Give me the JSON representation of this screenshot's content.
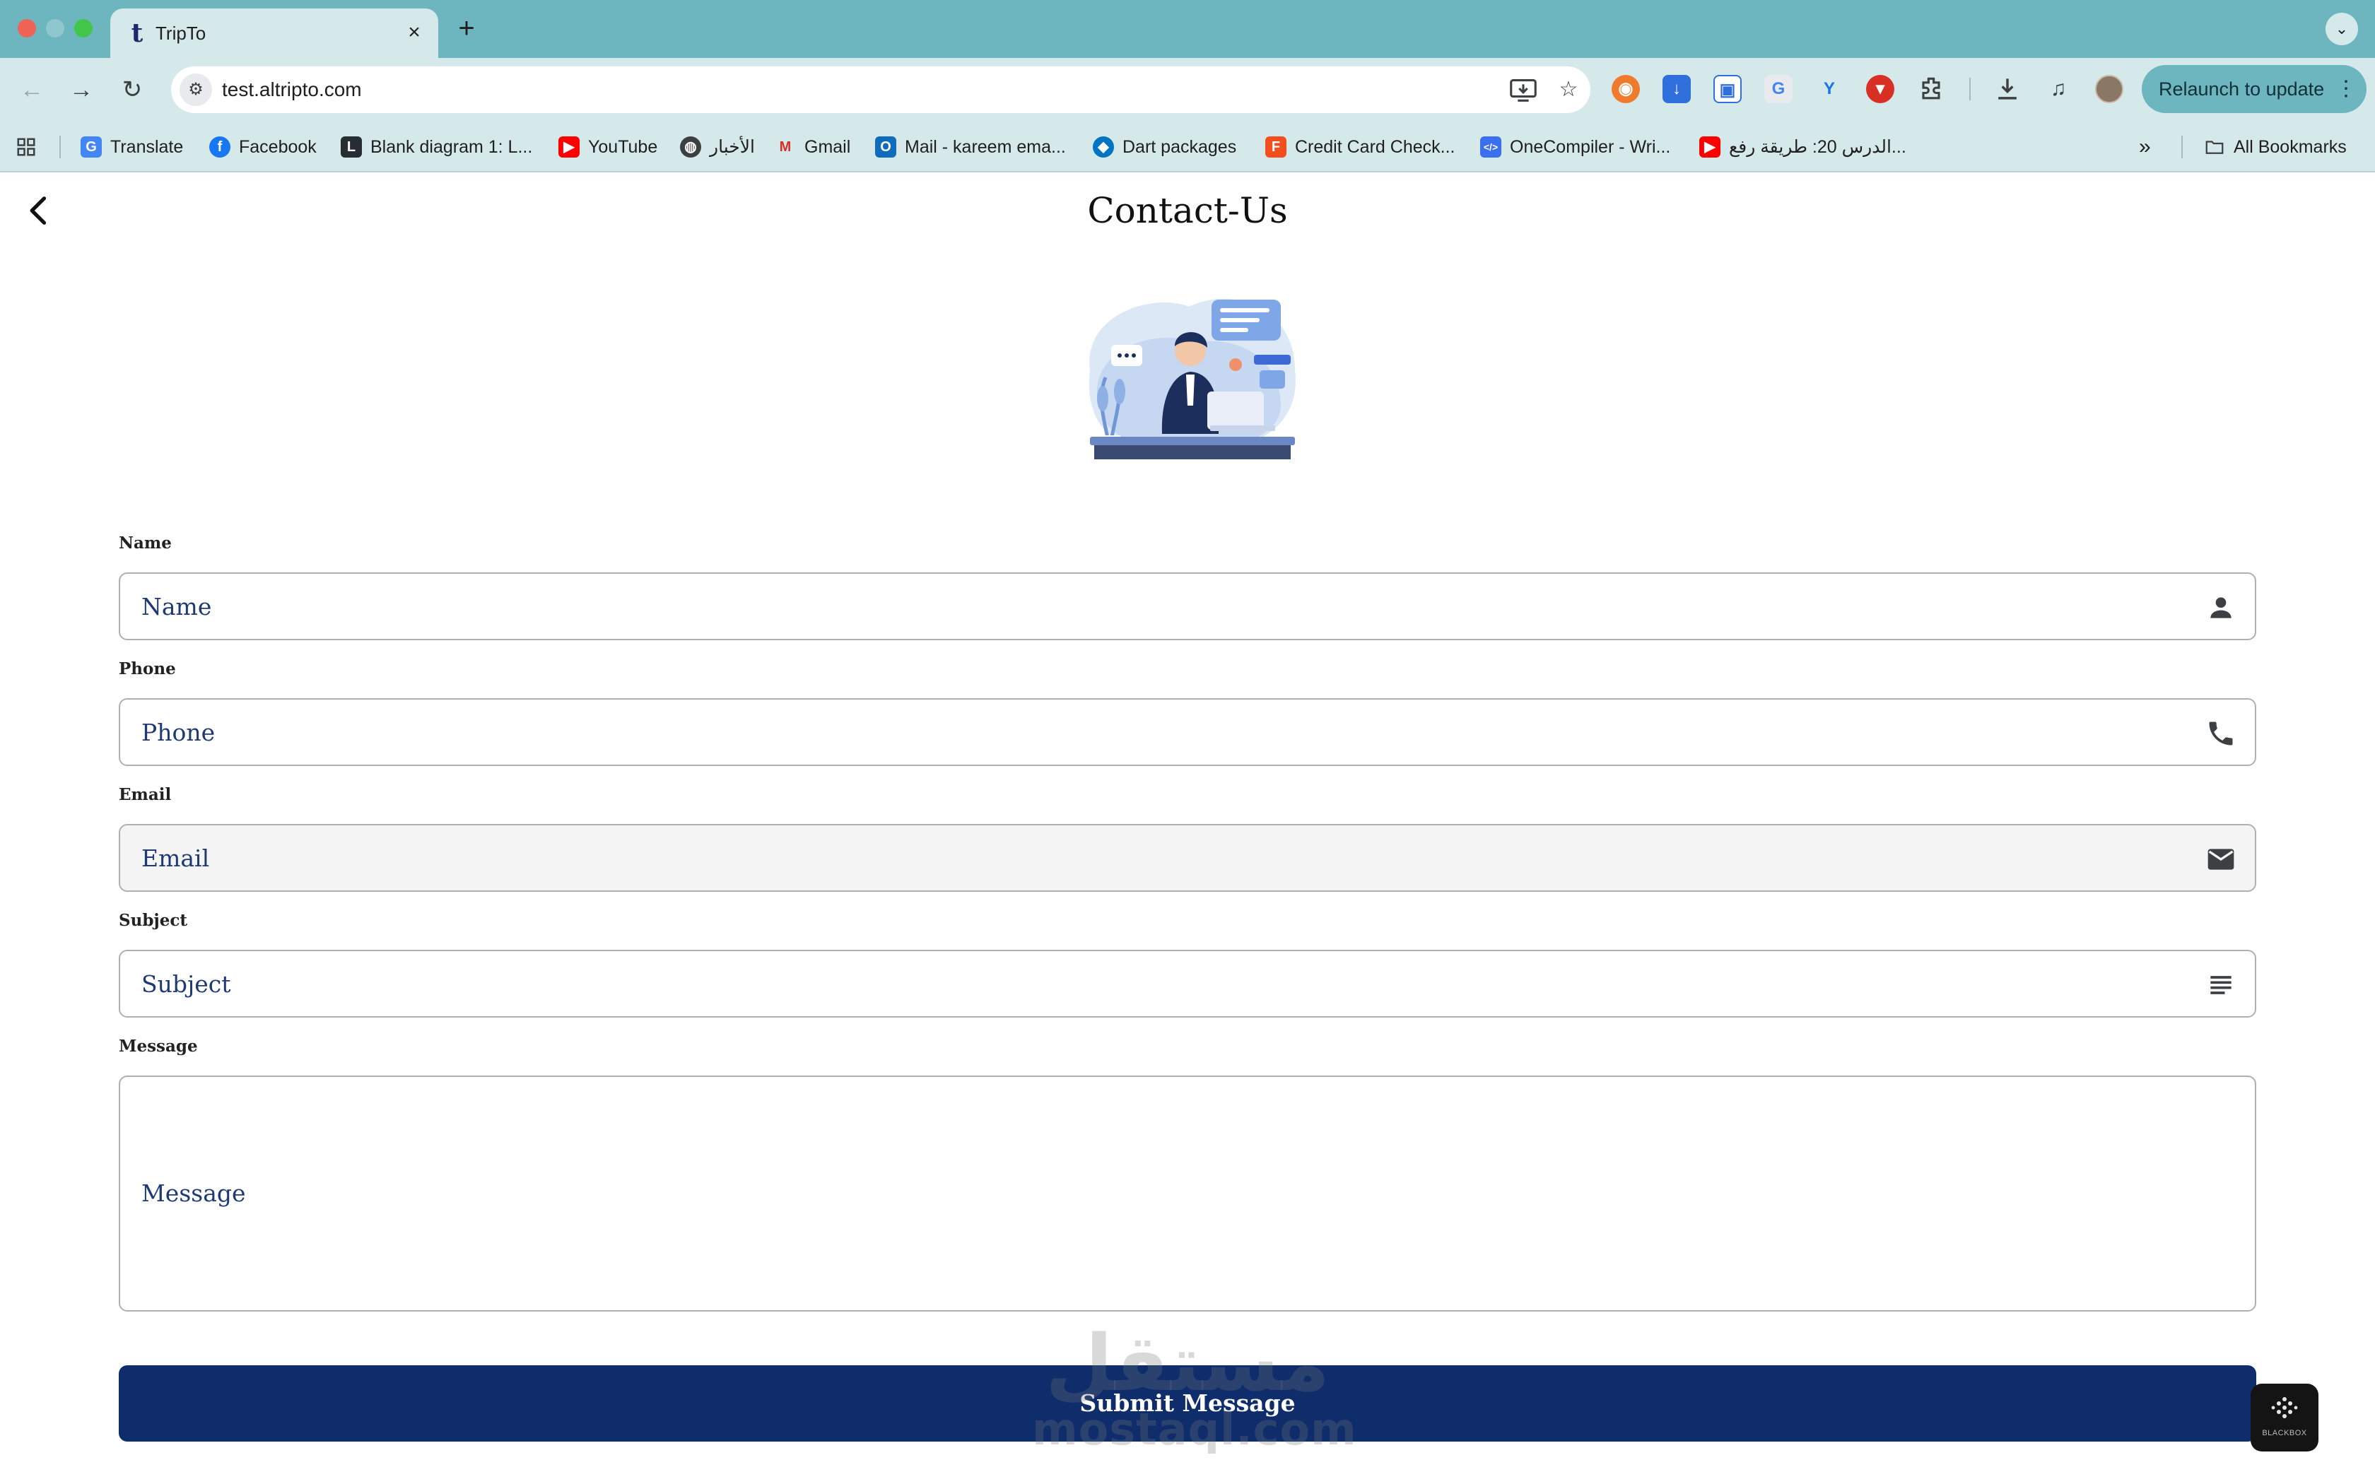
{
  "browser": {
    "tab": {
      "title": "TripTo",
      "favicon": "t"
    },
    "address_bar": {
      "url": "test.altripto.com"
    },
    "relaunch_label": "Relaunch to update",
    "bookmarks": [
      {
        "label": "Translate",
        "icon": "google-translate-icon"
      },
      {
        "label": "Facebook",
        "icon": "facebook-icon"
      },
      {
        "label": "Blank diagram 1: L...",
        "icon": "lucidchart-icon"
      },
      {
        "label": "YouTube",
        "icon": "youtube-icon"
      },
      {
        "label": "الأخبار",
        "icon": "globe-icon"
      },
      {
        "label": "Gmail",
        "icon": "gmail-icon"
      },
      {
        "label": "Mail - kareem ema...",
        "icon": "outlook-icon"
      },
      {
        "label": "Dart packages",
        "icon": "dart-icon"
      },
      {
        "label": "Credit Card Check...",
        "icon": "figma-icon"
      },
      {
        "label": "OneCompiler - Wri...",
        "icon": "code-icon"
      },
      {
        "label": "الدرس 20: طريقة رفع...",
        "icon": "youtube-icon"
      }
    ],
    "all_bookmarks_label": "All Bookmarks"
  },
  "page": {
    "title": "Contact-Us",
    "illustration": "customer-support-agent-illustration",
    "form": {
      "name": {
        "label": "Name",
        "placeholder": "Name",
        "icon": "person-icon"
      },
      "phone": {
        "label": "Phone",
        "placeholder": "Phone",
        "icon": "phone-icon"
      },
      "email": {
        "label": "Email",
        "placeholder": "Email",
        "icon": "envelope-icon"
      },
      "subject": {
        "label": "Subject",
        "placeholder": "Subject",
        "icon": "subject-lines-icon"
      },
      "message": {
        "label": "Message",
        "placeholder": "Message"
      },
      "submit_label": "Submit Message"
    },
    "watermark": {
      "arabic": "مستقل",
      "latin": "mostaql.com"
    },
    "floating_badge": "BLACKBOX"
  },
  "colors": {
    "tab_strip": "#6db6bf",
    "toolbar": "#d6e9ea",
    "primary_button": "#0f2d6b",
    "placeholder_text": "#1f3a73",
    "email_field_bg": "#f4f4f5"
  }
}
